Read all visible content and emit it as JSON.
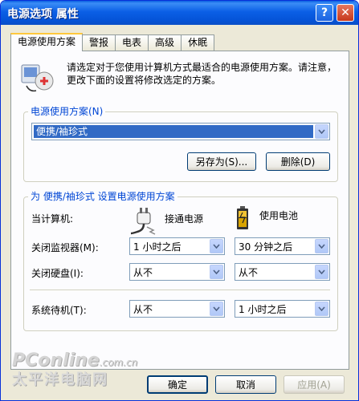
{
  "window": {
    "title": "电源选项 属性",
    "help_icon": "?",
    "close_icon": "✕"
  },
  "tabs": [
    {
      "label": "电源使用方案",
      "active": true
    },
    {
      "label": "警报"
    },
    {
      "label": "电表"
    },
    {
      "label": "高级"
    },
    {
      "label": "休眠"
    }
  ],
  "intro": {
    "text": "请选定对于您使用计算机方式最适合的电源使用方案。请注意，更改下面的设置将修改选定的方案。",
    "icon": "power-scheme-icon"
  },
  "scheme_group": {
    "label": "电源使用方案(N)",
    "selected": "便携/袖珍式",
    "save_as": "另存为(S)...",
    "delete": "删除(D)"
  },
  "settings_group": {
    "label": "为 便携/袖珍式 设置电源使用方案",
    "computer_label": "当计算机:",
    "plugged_in": "接通电源",
    "on_battery": "使用电池",
    "rows": [
      {
        "label": "关闭监视器(M):",
        "ac": "1 小时之后",
        "dc": "30 分钟之后"
      },
      {
        "label": "关闭硬盘(I):",
        "ac": "从不",
        "dc": "从不"
      },
      {
        "label": "系统待机(T):",
        "ac": "从不",
        "dc": "1 小时之后"
      }
    ]
  },
  "footer": {
    "ok": "确定",
    "cancel": "取消",
    "apply": "应用(A)"
  },
  "watermark": {
    "brand": "PConline",
    "domain": ".com.cn",
    "cn": "太平洋电脑网"
  }
}
